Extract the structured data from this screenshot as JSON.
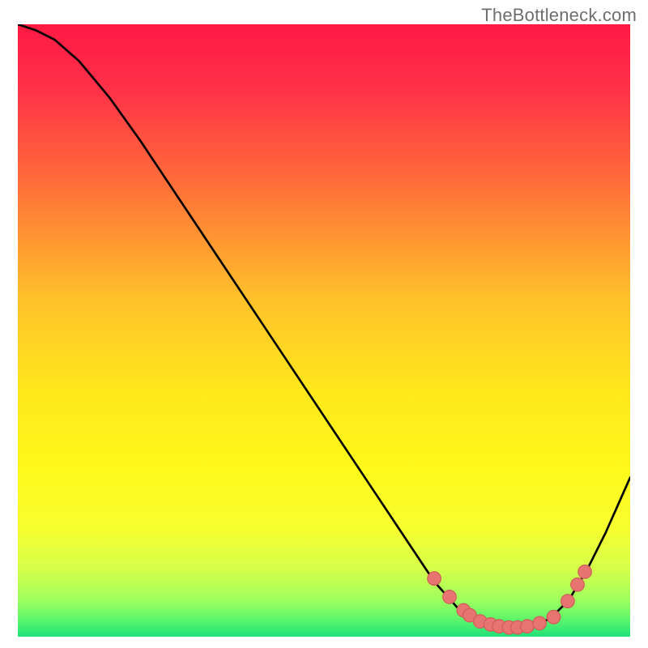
{
  "watermark": "TheBottleneck.com",
  "colors": {
    "gradient_stops": [
      {
        "offset": 0.0,
        "color": "#ff1a44"
      },
      {
        "offset": 0.1,
        "color": "#ff2f49"
      },
      {
        "offset": 0.25,
        "color": "#ff6a3a"
      },
      {
        "offset": 0.45,
        "color": "#ffc22a"
      },
      {
        "offset": 0.6,
        "color": "#ffe81c"
      },
      {
        "offset": 0.72,
        "color": "#fff81a"
      },
      {
        "offset": 0.82,
        "color": "#f8ff2e"
      },
      {
        "offset": 0.89,
        "color": "#d4ff4a"
      },
      {
        "offset": 0.94,
        "color": "#9fff5e"
      },
      {
        "offset": 0.975,
        "color": "#56f46b"
      },
      {
        "offset": 1.0,
        "color": "#20e07a"
      }
    ],
    "curve": "#000000",
    "dot_fill": "#e77471",
    "dot_stroke": "#cf5a57",
    "frame": "#ffffff"
  },
  "chart_data": {
    "type": "line",
    "title": "",
    "xlabel": "",
    "ylabel": "",
    "xlim": [
      0,
      100
    ],
    "ylim": [
      0,
      100
    ],
    "grid": false,
    "legend": false,
    "curve": [
      {
        "x": 0,
        "y": 100
      },
      {
        "x": 3,
        "y": 99
      },
      {
        "x": 6,
        "y": 97.5
      },
      {
        "x": 10,
        "y": 94
      },
      {
        "x": 15,
        "y": 88
      },
      {
        "x": 20,
        "y": 81
      },
      {
        "x": 30,
        "y": 66
      },
      {
        "x": 40,
        "y": 51
      },
      {
        "x": 50,
        "y": 36
      },
      {
        "x": 58,
        "y": 24
      },
      {
        "x": 64,
        "y": 15
      },
      {
        "x": 68,
        "y": 9
      },
      {
        "x": 72,
        "y": 4.5
      },
      {
        "x": 75,
        "y": 2.5
      },
      {
        "x": 78,
        "y": 1.6
      },
      {
        "x": 81,
        "y": 1.3
      },
      {
        "x": 84,
        "y": 1.6
      },
      {
        "x": 87,
        "y": 3.0
      },
      {
        "x": 90,
        "y": 6.0
      },
      {
        "x": 93,
        "y": 11
      },
      {
        "x": 96,
        "y": 17
      },
      {
        "x": 100,
        "y": 26
      }
    ],
    "dots": [
      {
        "x": 68.0,
        "y": 9.5
      },
      {
        "x": 70.5,
        "y": 6.5
      },
      {
        "x": 72.8,
        "y": 4.3
      },
      {
        "x": 73.8,
        "y": 3.5
      },
      {
        "x": 75.5,
        "y": 2.5
      },
      {
        "x": 77.2,
        "y": 2.0
      },
      {
        "x": 78.6,
        "y": 1.7
      },
      {
        "x": 80.2,
        "y": 1.5
      },
      {
        "x": 81.6,
        "y": 1.5
      },
      {
        "x": 83.2,
        "y": 1.7
      },
      {
        "x": 85.2,
        "y": 2.2
      },
      {
        "x": 87.5,
        "y": 3.2
      },
      {
        "x": 89.8,
        "y": 5.8
      },
      {
        "x": 91.4,
        "y": 8.5
      },
      {
        "x": 92.6,
        "y": 10.6
      }
    ],
    "dot_radius": 1.1
  }
}
